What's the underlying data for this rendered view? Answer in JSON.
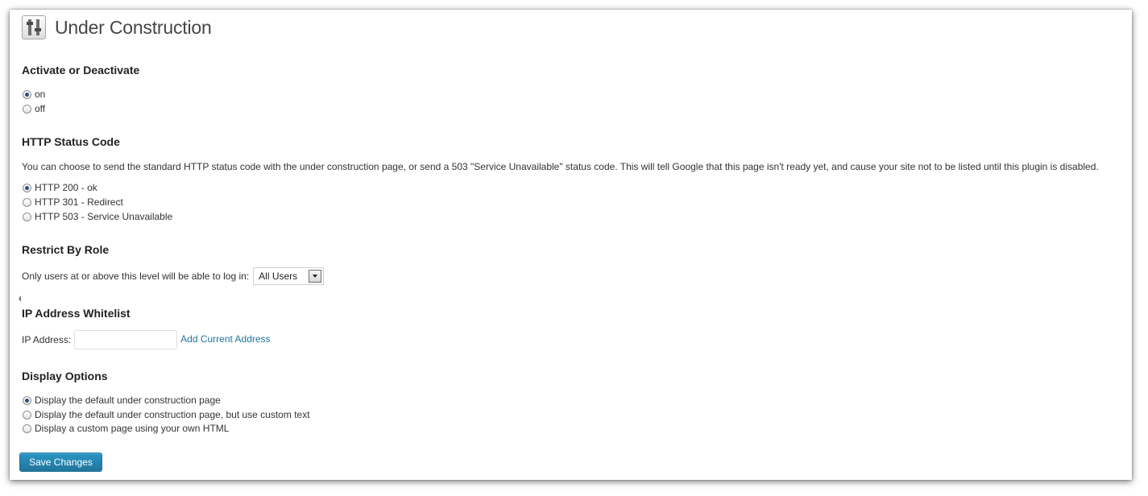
{
  "header": {
    "title": "Under Construction",
    "icon": "sliders-icon"
  },
  "activate": {
    "title": "Activate or Deactivate",
    "options": [
      {
        "label": "on",
        "checked": true
      },
      {
        "label": "off",
        "checked": false
      }
    ]
  },
  "http": {
    "title": "HTTP Status Code",
    "description": "You can choose to send the standard HTTP status code with the under construction page, or send a 503 \"Service Unavailable\" status code. This will tell Google that this page isn't ready yet, and cause your site not to be listed until this plugin is disabled.",
    "options": [
      {
        "label": "HTTP 200 - ok",
        "checked": true
      },
      {
        "label": "HTTP 301 - Redirect",
        "checked": false
      },
      {
        "label": "HTTP 503 - Service Unavailable",
        "checked": false
      }
    ]
  },
  "role": {
    "title": "Restrict By Role",
    "label": "Only users at or above this level will be able to log in:",
    "selected": "All Users"
  },
  "ip": {
    "title": "IP Address Whitelist",
    "label": "IP Address:",
    "value": "",
    "add_link": "Add Current Address"
  },
  "display": {
    "title": "Display Options",
    "options": [
      {
        "label": "Display the default under construction page",
        "checked": true
      },
      {
        "label": "Display the default under construction page, but use custom text",
        "checked": false
      },
      {
        "label": "Display a custom page using your own HTML",
        "checked": false
      }
    ]
  },
  "actions": {
    "save_label": "Save Changes"
  },
  "colors": {
    "accent": "#21759b",
    "button_top": "#2a95c5",
    "text": "#333333",
    "heading": "#222222"
  }
}
